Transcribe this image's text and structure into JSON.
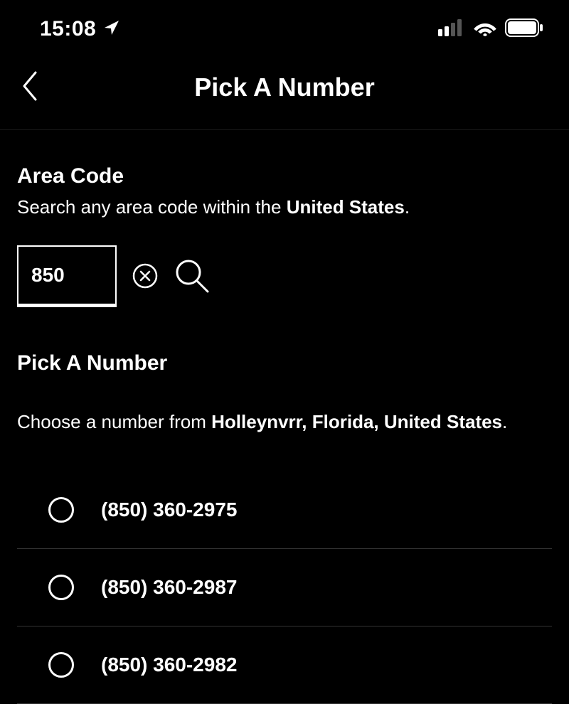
{
  "statusBar": {
    "time": "15:08"
  },
  "header": {
    "title": "Pick A Number"
  },
  "areaCode": {
    "heading": "Area Code",
    "descriptionPrefix": "Search any area code within the ",
    "descriptionBold": "United States",
    "descriptionSuffix": ".",
    "value": "850"
  },
  "pickNumber": {
    "heading": "Pick A Number",
    "descriptionPrefix": "Choose a number from ",
    "descriptionBold": "Holleynvrr, Florida, United States",
    "descriptionSuffix": "."
  },
  "numbers": [
    {
      "display": "(850) 360-2975"
    },
    {
      "display": "(850) 360-2987"
    },
    {
      "display": "(850) 360-2982"
    }
  ]
}
